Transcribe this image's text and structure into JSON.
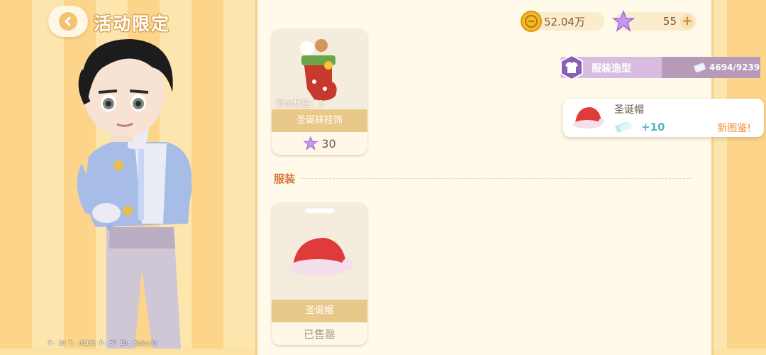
{
  "header": {
    "title": "活动限定"
  },
  "currency": {
    "coins": "52.04万",
    "stars": "55",
    "add_label": "+"
  },
  "items": {
    "sock": {
      "remaining": "剩余数量：1",
      "name": "圣诞袜挂饰",
      "price": "30"
    },
    "section_label": "服装",
    "hat": {
      "name": "圣诞帽",
      "status": "已售罄"
    }
  },
  "stat_bar": {
    "label": "服装造型",
    "value": "4694/9239",
    "progress": 0.508
  },
  "notice": {
    "item_name": "圣诞帽",
    "reward": "+10",
    "new_label": "新图鉴!"
  },
  "debug": "F: 30   T: 41172   P: 57   ID: 6h3ry7y",
  "colors": {
    "accent_orange": "#d8763a",
    "stat_purple": "#b799b8",
    "gold_band": "#e8c98a"
  },
  "icons": [
    "back-chevron-icon",
    "coin-icon",
    "star-icon",
    "plus-icon",
    "shirt-icon",
    "ticket-icon",
    "santa-hat-icon",
    "christmas-stocking-icon"
  ]
}
